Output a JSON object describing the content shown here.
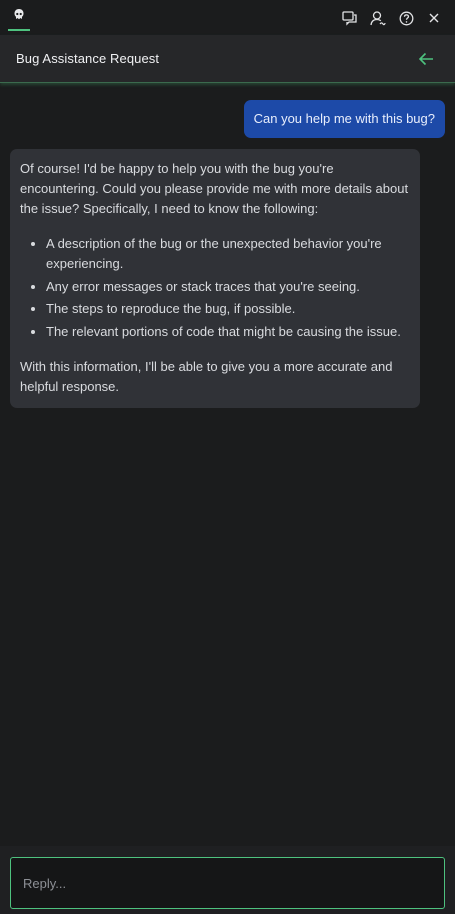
{
  "topbar": {
    "icons": [
      "logo-icon",
      "chat-icon",
      "profile-icon",
      "help-icon",
      "close-icon"
    ]
  },
  "header": {
    "title": "Bug Assistance Request"
  },
  "messages": {
    "user": "Can you help me with this bug?",
    "bot": {
      "intro": "Of course! I'd be happy to help you with the bug you're encountering. Could you please provide me with more details about the issue? Specifically, I need to know the following:",
      "items": [
        "A description of the bug or the unexpected behavior you're experiencing.",
        "Any error messages or stack traces that you're seeing.",
        "The steps to reproduce the bug, if possible.",
        "The relevant portions of code that might be causing the issue."
      ],
      "outro": "With this information, I'll be able to give you a more accurate and helpful response."
    }
  },
  "composer": {
    "placeholder": "Reply..."
  },
  "colors": {
    "accent": "#4ec27f",
    "user_bubble": "#1d4aa8",
    "bot_bubble": "#303237",
    "background": "#1b1c1d"
  }
}
